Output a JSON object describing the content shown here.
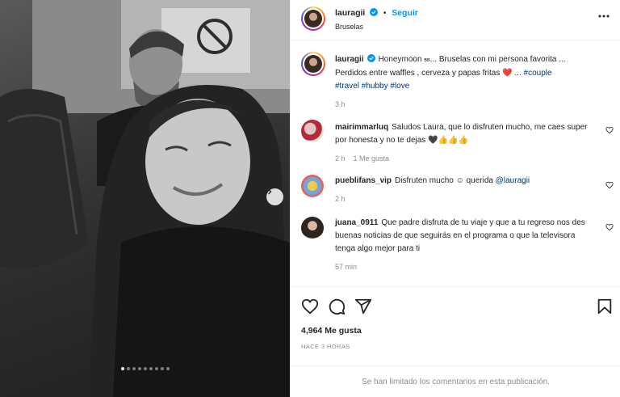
{
  "post": {
    "username": "lauragii",
    "follow_label": "Seguir",
    "location": "Bruselas",
    "more_icon": "more-horizontal-icon"
  },
  "caption": {
    "username": "lauragii",
    "text_before_heart": "Honeymoon",
    "small_caps": "вв",
    "text_line1": "... Bruselas con mi persona favorita ...",
    "text_line2": "Perdidos entre waffles , cerveza y papas fritas",
    "heart": "❤️",
    "ellipsis": " ... ",
    "tags": [
      "#couple",
      "#travel",
      "#hubby",
      "#love"
    ],
    "time": "3 h"
  },
  "comments": [
    {
      "username": "mairimmarluq",
      "text": "Saludos Laura, que lo disfruten mucho, me caes super por honesta y no te dejas",
      "emojis": "🖤👍👍👍",
      "time": "2 h",
      "likes": "1 Me gusta"
    },
    {
      "username": "pueblifans_vip",
      "text": "Disfruten mucho",
      "emoji": "☺",
      "text2": "querida",
      "mention": "@lauragii",
      "time": "2 h"
    },
    {
      "username": "juana_0911",
      "text": "Que padre disfruta de tu viaje y que a tu regreso nos des buenas noticias de que seguirás en el programa o que la televisora tenga algo mejor para ti",
      "time": "57 min"
    }
  ],
  "actions": {
    "likes": "4,964 Me gusta",
    "posted": "HACE 3 HORAS",
    "limited": "Se han limitado los comentarios en esta publicación."
  },
  "carousel": {
    "total": 9,
    "active": 1
  },
  "colors": {
    "accent": "#0095f6",
    "heart": "#ed4956",
    "link": "#00376b",
    "muted": "#8e8e8e"
  }
}
